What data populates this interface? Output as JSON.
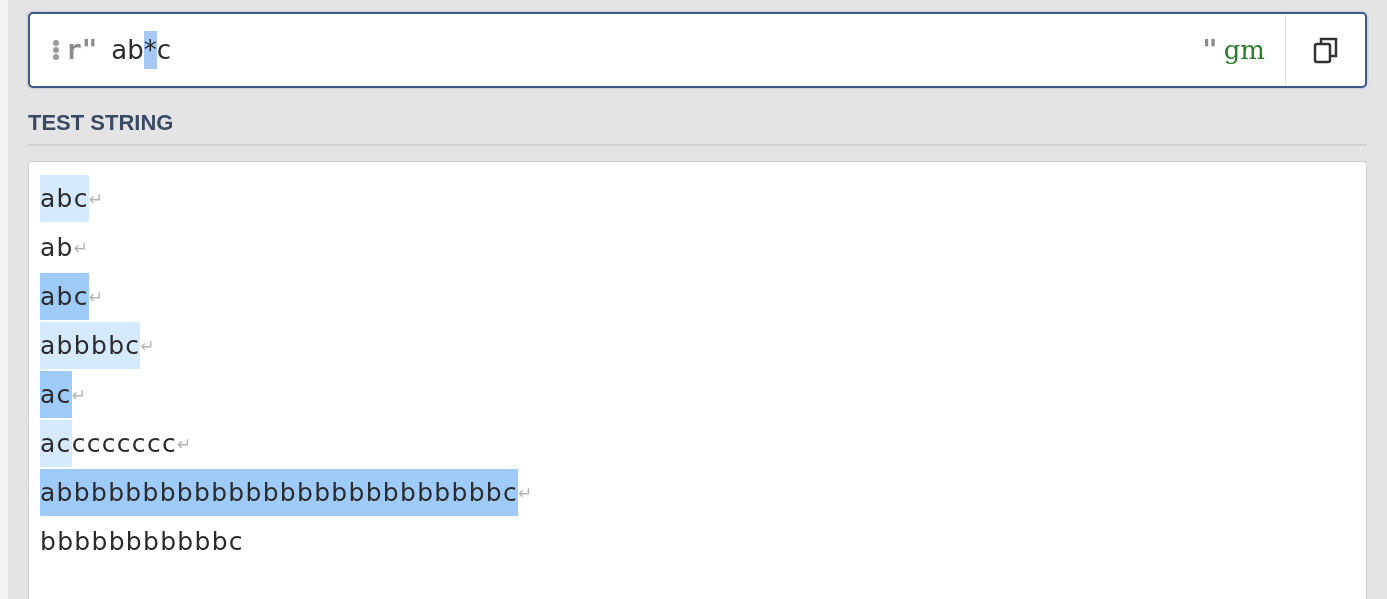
{
  "regex": {
    "prefix": "r\"",
    "tokens": [
      {
        "text": "ab",
        "selected": false
      },
      {
        "text": "*",
        "selected": true
      },
      {
        "text": "c",
        "selected": false
      }
    ],
    "suffix": "\"",
    "flags": "gm"
  },
  "test_string": {
    "heading": "TEST STRING",
    "lines": [
      {
        "match": "abc",
        "alternate": false,
        "end_mark": "↵"
      },
      {
        "rest": "ab",
        "end_mark": "↵"
      },
      {
        "match": "abc",
        "alternate": true,
        "end_mark": "↵"
      },
      {
        "match": "abbbbc",
        "alternate": false,
        "end_mark": "↵"
      },
      {
        "match": "ac",
        "alternate": true,
        "end_mark": "↵"
      },
      {
        "match": "ac",
        "rest": "ccccccc",
        "alternate": false,
        "end_mark": "↵"
      },
      {
        "match": "abbbbbbbbbbbbbbbbbbbbbbbbbbc",
        "alternate": true,
        "end_mark": "↵"
      },
      {
        "rest": "bbbbbbbbbbbc"
      }
    ]
  }
}
